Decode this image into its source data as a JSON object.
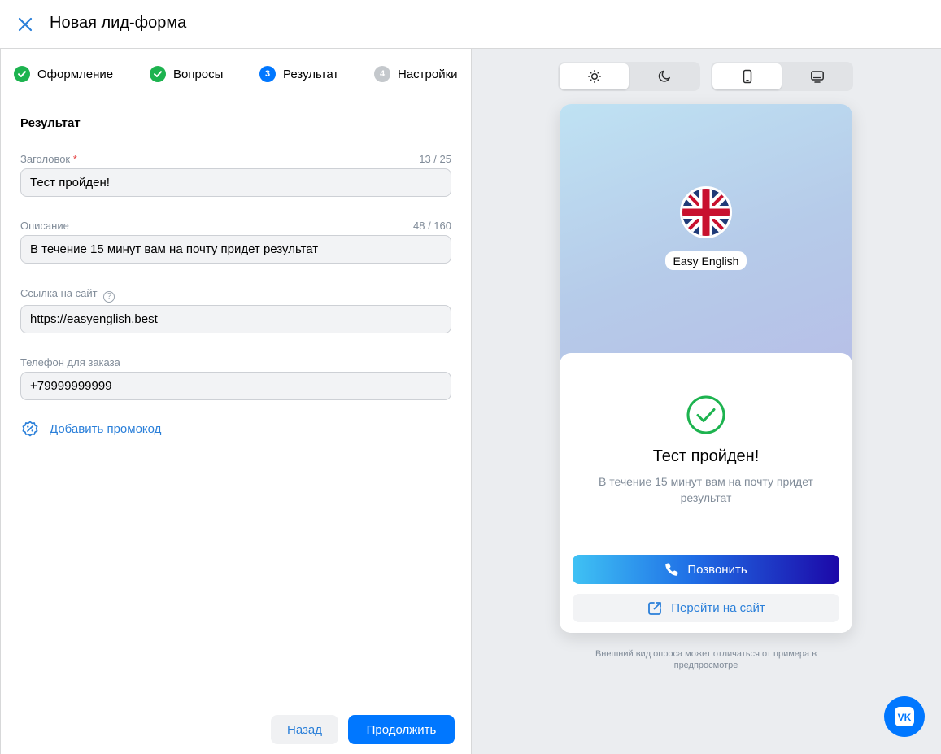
{
  "header": {
    "title": "Новая лид-форма"
  },
  "steps": [
    {
      "num": "",
      "label": "Оформление",
      "state": "done"
    },
    {
      "num": "",
      "label": "Вопросы",
      "state": "done"
    },
    {
      "num": "3",
      "label": "Результат",
      "state": "active"
    },
    {
      "num": "4",
      "label": "Настройки",
      "state": "todo"
    }
  ],
  "form": {
    "section_title": "Результат",
    "title_field": {
      "label": "Заголовок",
      "required_mark": "*",
      "counter": "13 / 25",
      "value": "Тест пройден!"
    },
    "desc_field": {
      "label": "Описание",
      "counter": "48 / 160",
      "value": "В течение 15 минут вам на почту придет результат"
    },
    "link_field": {
      "label": "Ссылка на сайт",
      "help": "?",
      "value": "https://easyenglish.best"
    },
    "phone_field": {
      "label": "Телефон для заказа",
      "value": "+79999999999"
    },
    "promo_label": "Добавить промокод"
  },
  "footer": {
    "back_label": "Назад",
    "next_label": "Продолжить"
  },
  "preview": {
    "theme_options": [
      "light",
      "dark"
    ],
    "theme_selected": "light",
    "device_options": [
      "mobile",
      "desktop"
    ],
    "device_selected": "mobile",
    "brand_name": "Easy English",
    "result_title": "Тест пройден!",
    "result_desc": "В течение 15 минут вам на почту придет результат",
    "call_label": "Позвонить",
    "site_label": "Перейти на сайт",
    "note": "Внешний вид опроса может отличаться от примера в предпросмотре"
  },
  "colors": {
    "accent": "#0077ff",
    "link": "#2a7fd9",
    "success": "#1db34f",
    "muted": "#818c99"
  },
  "icons": {
    "close": "close-icon",
    "step_done": "check-circle-icon",
    "promo": "discount-badge-icon",
    "theme_light": "sun-icon",
    "theme_dark": "moon-icon",
    "device_mobile": "phone-device-icon",
    "device_desktop": "monitor-icon",
    "result": "check-circle-outline-icon",
    "call": "phone-icon",
    "site": "external-link-icon",
    "fab": "vk-logo-icon"
  }
}
